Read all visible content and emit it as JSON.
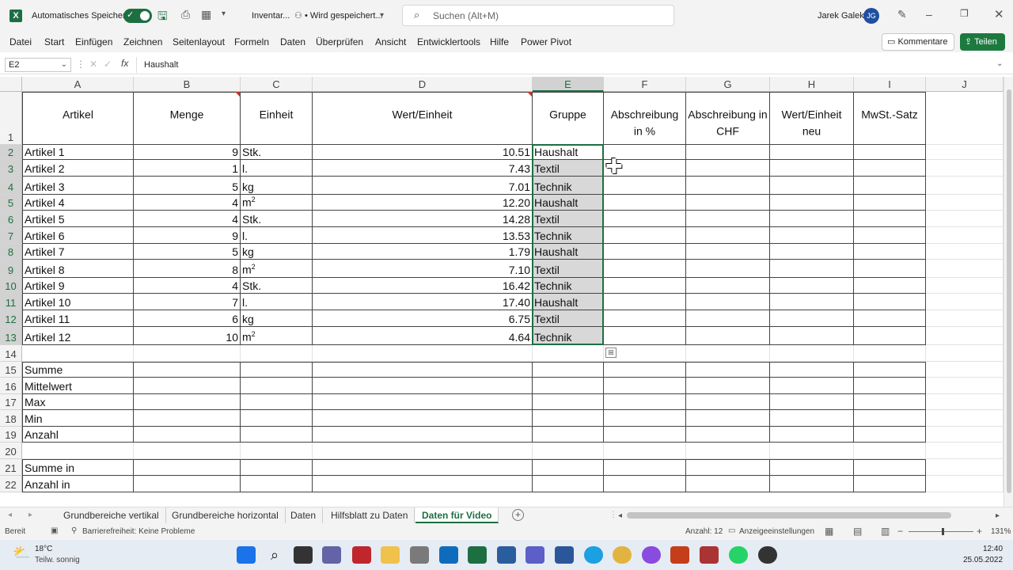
{
  "titlebar": {
    "autosave_label": "Automatisches Speichern",
    "file_name": "Inventar...",
    "save_status": "• Wird gespeichert...",
    "search_placeholder": "Suchen (Alt+M)",
    "user_name": "Jarek Galek",
    "user_initials": "JG"
  },
  "menu": {
    "items": [
      "Datei",
      "Start",
      "Einfügen",
      "Zeichnen",
      "Seitenlayout",
      "Formeln",
      "Daten",
      "Überprüfen",
      "Ansicht",
      "Entwicklertools",
      "Hilfe",
      "Power Pivot"
    ],
    "comments_label": "Kommentare",
    "share_label": "Teilen"
  },
  "formula_bar": {
    "cell_ref": "E2",
    "fx": "fx",
    "content": "Haushalt"
  },
  "columns": [
    "A",
    "B",
    "C",
    "D",
    "E",
    "F",
    "G",
    "H",
    "I",
    "J"
  ],
  "rows": [
    "1",
    "2",
    "3",
    "4",
    "5",
    "6",
    "7",
    "8",
    "9",
    "10",
    "11",
    "12",
    "13",
    "14",
    "15",
    "16",
    "17",
    "18",
    "19",
    "20",
    "21",
    "22"
  ],
  "headers": {
    "A": "Artikel",
    "B": "Menge",
    "C": "Einheit",
    "D": "Wert/Einheit",
    "E": "Gruppe",
    "F": "Abschreibung in %",
    "G": "Abschreibung in CHF",
    "H": "Wert/Einheit neu",
    "I": "MwSt.-Satz"
  },
  "data_rows": [
    {
      "artikel": "Artikel 1",
      "menge": "9",
      "einheit": "Stk.",
      "sup": "",
      "wert": "10.51",
      "gruppe": "Haushalt"
    },
    {
      "artikel": "Artikel 2",
      "menge": "1",
      "einheit": "l.",
      "sup": "",
      "wert": "7.43",
      "gruppe": "Textil"
    },
    {
      "artikel": "Artikel 3",
      "menge": "5",
      "einheit": "kg",
      "sup": "",
      "wert": "7.01",
      "gruppe": "Technik"
    },
    {
      "artikel": "Artikel 4",
      "menge": "4",
      "einheit": "m",
      "sup": "2",
      "wert": "12.20",
      "gruppe": "Haushalt"
    },
    {
      "artikel": "Artikel 5",
      "menge": "4",
      "einheit": "Stk.",
      "sup": "",
      "wert": "14.28",
      "gruppe": "Textil"
    },
    {
      "artikel": "Artikel 6",
      "menge": "9",
      "einheit": "l.",
      "sup": "",
      "wert": "13.53",
      "gruppe": "Technik"
    },
    {
      "artikel": "Artikel 7",
      "menge": "5",
      "einheit": "kg",
      "sup": "",
      "wert": "1.79",
      "gruppe": "Haushalt"
    },
    {
      "artikel": "Artikel 8",
      "menge": "8",
      "einheit": "m",
      "sup": "2",
      "wert": "7.10",
      "gruppe": "Textil"
    },
    {
      "artikel": "Artikel 9",
      "menge": "4",
      "einheit": "Stk.",
      "sup": "",
      "wert": "16.42",
      "gruppe": "Technik"
    },
    {
      "artikel": "Artikel 10",
      "menge": "7",
      "einheit": "l.",
      "sup": "",
      "wert": "17.40",
      "gruppe": "Haushalt"
    },
    {
      "artikel": "Artikel 11",
      "menge": "6",
      "einheit": "kg",
      "sup": "",
      "wert": "6.75",
      "gruppe": "Textil"
    },
    {
      "artikel": "Artikel 12",
      "menge": "10",
      "einheit": "m",
      "sup": "2",
      "wert": "4.64",
      "gruppe": "Technik"
    }
  ],
  "summary_rows": [
    "Summe",
    "Mittelwert",
    "Max",
    "Min",
    "Anzahl"
  ],
  "summary_rows_2": [
    "Summe in",
    "Anzahl in"
  ],
  "sheet_tabs": [
    "Grundbereiche vertikal",
    "Grundbereiche horizontal",
    "Daten",
    "Hilfsblatt zu Daten",
    "Daten für Video"
  ],
  "active_tab": "Daten für Video",
  "status": {
    "ready": "Bereit",
    "accessibility": "Barrierefreiheit: Keine Probleme",
    "count": "Anzahl: 12",
    "display_settings": "Anzeigeeinstellungen",
    "zoom": "131%"
  },
  "taskbar": {
    "temp": "18°C",
    "weather": "Teilw. sonnig",
    "time": "12:40",
    "date": "25.05.2022"
  },
  "colors": {
    "excel_green": "#1d6f42",
    "selection_gray": "#d8d8d8",
    "note_red": "#c0392b"
  }
}
